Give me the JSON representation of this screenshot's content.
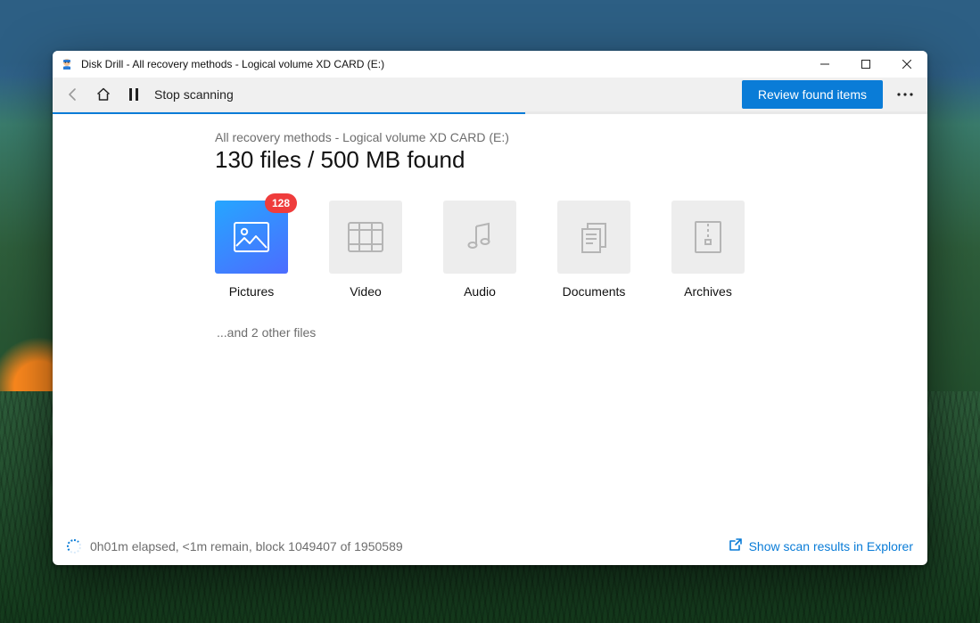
{
  "window": {
    "title": "Disk Drill - All recovery methods - Logical volume XD CARD (E:)"
  },
  "toolbar": {
    "stop_label": "Stop scanning",
    "review_label": "Review found items"
  },
  "progress": {
    "percent": 54
  },
  "main": {
    "breadcrumb": "All recovery methods - Logical volume XD CARD (E:)",
    "summary": "130 files / 500 MB found",
    "categories": [
      {
        "label": "Pictures",
        "icon": "picture-icon",
        "active": true,
        "badge": "128"
      },
      {
        "label": "Video",
        "icon": "video-icon",
        "active": false,
        "badge": null
      },
      {
        "label": "Audio",
        "icon": "audio-icon",
        "active": false,
        "badge": null
      },
      {
        "label": "Documents",
        "icon": "document-icon",
        "active": false,
        "badge": null
      },
      {
        "label": "Archives",
        "icon": "archive-icon",
        "active": false,
        "badge": null
      }
    ],
    "other_files": "...and 2 other files"
  },
  "footer": {
    "status": "0h01m elapsed, <1m remain, block 1049407 of 1950589",
    "explorer_link": "Show scan results in Explorer"
  }
}
